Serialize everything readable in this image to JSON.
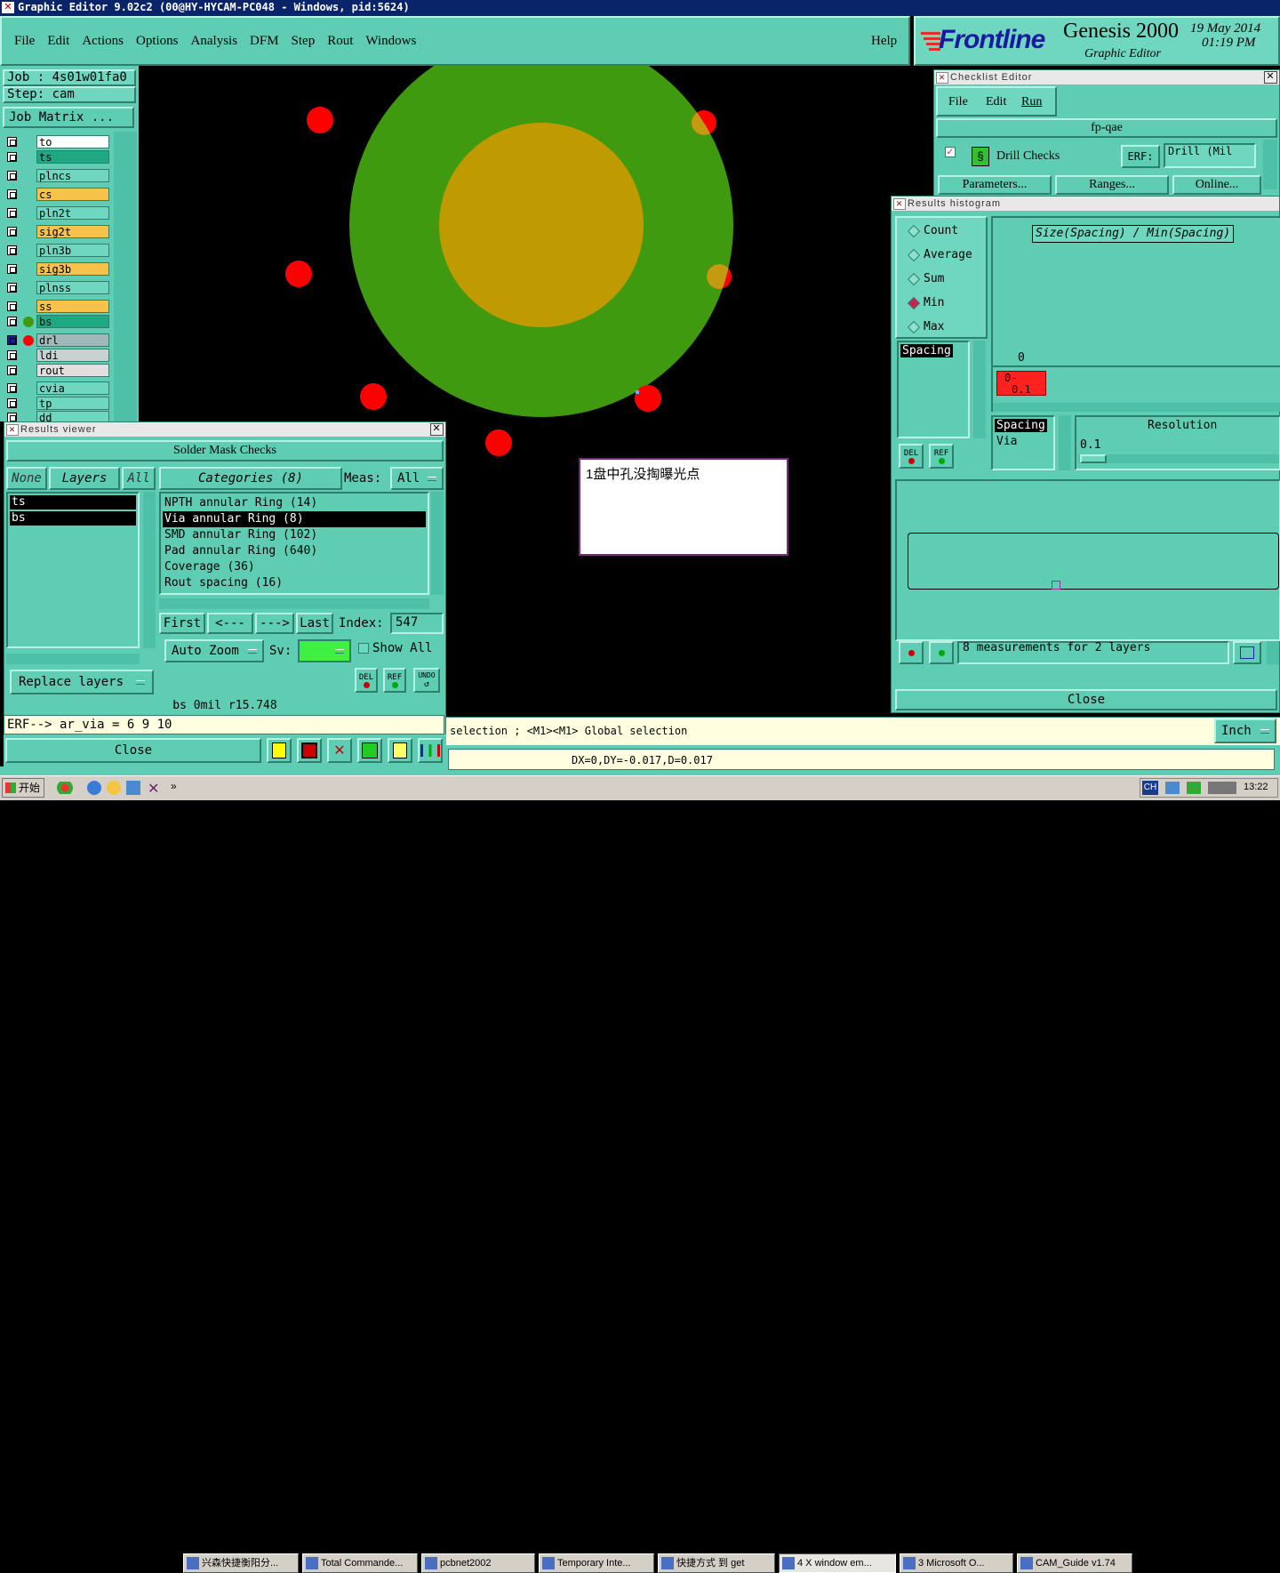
{
  "app": {
    "title": "Graphic Editor 9.02c2  (00@HY-HYCAM-PC048 - Windows, pid:5624)",
    "menu": [
      "File",
      "Edit",
      "Actions",
      "Options",
      "Analysis",
      "DFM",
      "Step",
      "Rout",
      "Windows"
    ],
    "help": "Help",
    "brand": "Frontline",
    "product": "Genesis 2000",
    "product_sub": "Graphic Editor",
    "date": "19 May 2014",
    "time": "01:19 PM"
  },
  "job_panel": {
    "job": "Job : 4s01w01fa0",
    "step": "Step: cam",
    "matrix_button": "Job Matrix ...",
    "layers": [
      {
        "name": "to",
        "color": "#ffffff"
      },
      {
        "name": "ts",
        "color": "#1fa882"
      },
      {
        "name": "plncs",
        "color": "#6fd6c0"
      },
      {
        "name": "cs",
        "color": "#f7c24a"
      },
      {
        "name": "pln2t",
        "color": "#6fd6c0"
      },
      {
        "name": "sig2t",
        "color": "#f7c24a"
      },
      {
        "name": "pln3b",
        "color": "#6fd6c0"
      },
      {
        "name": "sig3b",
        "color": "#f7c24a"
      },
      {
        "name": "plnss",
        "color": "#6fd6c0"
      },
      {
        "name": "ss",
        "color": "#f7c24a"
      },
      {
        "name": "bs",
        "color": "#1fa882"
      },
      {
        "name": "drl",
        "color": "#9fb8b8"
      },
      {
        "name": "ldi",
        "color": "#c8d0d0"
      },
      {
        "name": "rout",
        "color": "#e0e0e0"
      },
      {
        "name": "cvia",
        "color": "#6fd6c0"
      },
      {
        "name": "tp",
        "color": "#6fd6c0"
      },
      {
        "name": "dd",
        "color": "#6fd6c0"
      }
    ]
  },
  "canvas": {
    "note": "1盘中孔没掏曝光点",
    "colors": {
      "outer": "#3f9a10",
      "inner": "#bf9a00",
      "drill": "#ff0000"
    }
  },
  "results_viewer": {
    "title": "Results viewer",
    "header": "Solder Mask Checks",
    "tabs": {
      "none": "None",
      "layers": "Layers",
      "all": "All"
    },
    "categories_label": "Categories (8)",
    "meas_label": "Meas:",
    "meas_value": "All",
    "layers": [
      "ts",
      "bs"
    ],
    "categories": [
      "NPTH annular Ring (14)",
      "Via annular Ring (8)",
      "SMD annular Ring (102)",
      "Pad annular Ring (640)",
      "Coverage (36)",
      "Rout spacing (16)"
    ],
    "selected_category": 1,
    "nav": {
      "first": "First",
      "prev": "<---",
      "next": "--->",
      "last": "Last",
      "index_label": "Index:",
      "index_value": "547"
    },
    "auto_zoom": "Auto Zoom",
    "sv_label": "Sv:",
    "show_all": "Show All",
    "replace_layers": "Replace layers",
    "icons": {
      "del": "DEL",
      "ref": "REF",
      "undo": "UNDO"
    },
    "status": "bs  0mil   r15.748",
    "erf": "ERF--> ar_via = 6 9 10",
    "close": "Close"
  },
  "checklist_editor": {
    "title": "Checklist Editor",
    "menu": [
      "File",
      "Edit",
      "Run"
    ],
    "name": "fp-qae",
    "check": "Drill Checks",
    "erf_label": "ERF:",
    "erf_value": "Drill (Mil",
    "buttons": [
      "Parameters...",
      "Ranges...",
      "Online..."
    ]
  },
  "histogram": {
    "title": "Results histogram",
    "options": [
      "Count",
      "Average",
      "Sum",
      "Min",
      "Max"
    ],
    "selected": "Min",
    "list_item": "Spacing",
    "chart_title": "Size(Spacing) / Min(Spacing)",
    "bar_top": "0",
    "bar_label_1": "0-",
    "bar_label_2": "0.1",
    "lower_list": [
      "Spacing",
      "Via"
    ],
    "resolution_label": "Resolution",
    "resolution_value": "0.1",
    "measurements": "8 measurements for 2 layers",
    "close": "Close",
    "icons": {
      "del": "DEL",
      "ref": "REF"
    }
  },
  "bottom": {
    "prompt": "selection ; <M1><M1> Global selection",
    "units": "Inch",
    "coords": "DX=0,DY=-0.017,D=0.017"
  },
  "taskbar": {
    "start": "开始",
    "tasks": [
      "兴森快捷衡阳分...",
      "Total Commande...",
      "pcbnet2002",
      "Temporary Inte...",
      "快捷方式 到 get",
      "4 X window em...",
      "3 Microsoft O...",
      "CAM_Guide v1.74"
    ],
    "lang": "CH",
    "clock": "13:22"
  }
}
